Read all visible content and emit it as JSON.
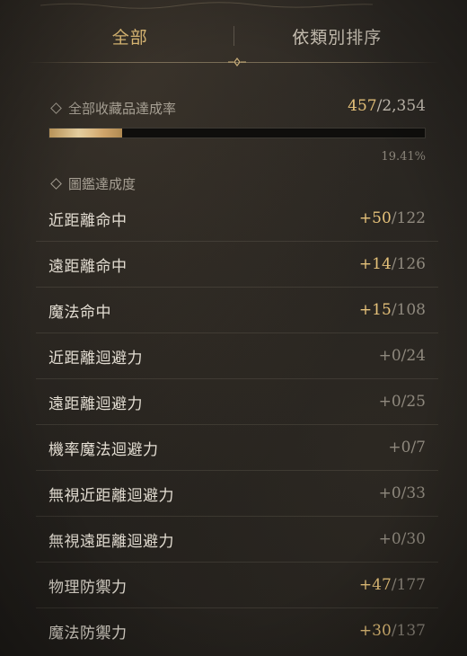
{
  "tabs": [
    {
      "label": "全部",
      "active": true
    },
    {
      "label": "依類別排序",
      "active": false
    }
  ],
  "overall": {
    "title": "全部收藏品達成率",
    "current": "457",
    "total": "2,354",
    "progress_fraction": 0.1941,
    "percent_text": "19.41%"
  },
  "codex_section": {
    "title": "圖鑑達成度"
  },
  "stats": [
    {
      "label": "近距離命中",
      "bonus": "+50",
      "total": "/122",
      "highlight": true
    },
    {
      "label": "遠距離命中",
      "bonus": "+14",
      "total": "/126",
      "highlight": true
    },
    {
      "label": "魔法命中",
      "bonus": "+15",
      "total": "/108",
      "highlight": true
    },
    {
      "label": "近距離迴避力",
      "bonus": "+0",
      "total": "/24",
      "highlight": false
    },
    {
      "label": "遠距離迴避力",
      "bonus": "+0",
      "total": "/25",
      "highlight": false
    },
    {
      "label": "機率魔法迴避力",
      "bonus": "+0",
      "total": "/7",
      "highlight": false
    },
    {
      "label": "無視近距離迴避力",
      "bonus": "+0",
      "total": "/33",
      "highlight": false
    },
    {
      "label": "無視遠距離迴避力",
      "bonus": "+0",
      "total": "/30",
      "highlight": false
    },
    {
      "label": "物理防禦力",
      "bonus": "+47",
      "total": "/177",
      "highlight": true
    },
    {
      "label": "魔法防禦力",
      "bonus": "+30",
      "total": "/137",
      "highlight": true
    }
  ],
  "colors": {
    "gold": "#e6c27a",
    "text": "#e3ddd2",
    "muted": "#8f897e",
    "background": "#24211d"
  },
  "icons": {
    "section_marker": "diamond-icon"
  }
}
